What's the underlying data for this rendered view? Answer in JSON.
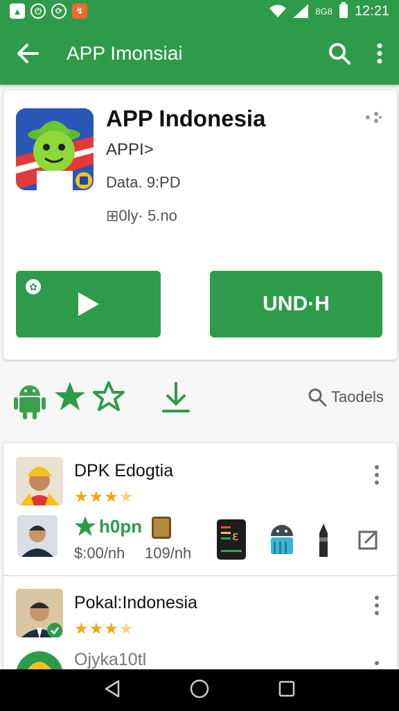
{
  "status_bar": {
    "left_icons": [
      "photo-icon",
      "power-icon",
      "sync-icon",
      "notification-icon"
    ],
    "signal_label": "8G8",
    "time": "12:21"
  },
  "toolbar": {
    "title": "APP Imonsiai"
  },
  "app": {
    "title": "APP Indonesia",
    "developer": "APPI>",
    "date": "Data. 9:PD",
    "size": "⊞0ly· 5.no",
    "install_label": "UND·H"
  },
  "icon_row": {
    "label": "Taodels"
  },
  "list": {
    "items": [
      {
        "title": "DPK Edogtia",
        "rating": 3.5,
        "sub_label": "h0pn",
        "price_1": "$:00/nh",
        "price_2": "109/nh"
      },
      {
        "title": "Pokal:Indonesia",
        "rating": 3.5
      },
      {
        "title": "Ojyka10tl"
      }
    ]
  },
  "colors": {
    "primary": "#2e9b4a",
    "star": "#f3a516"
  }
}
